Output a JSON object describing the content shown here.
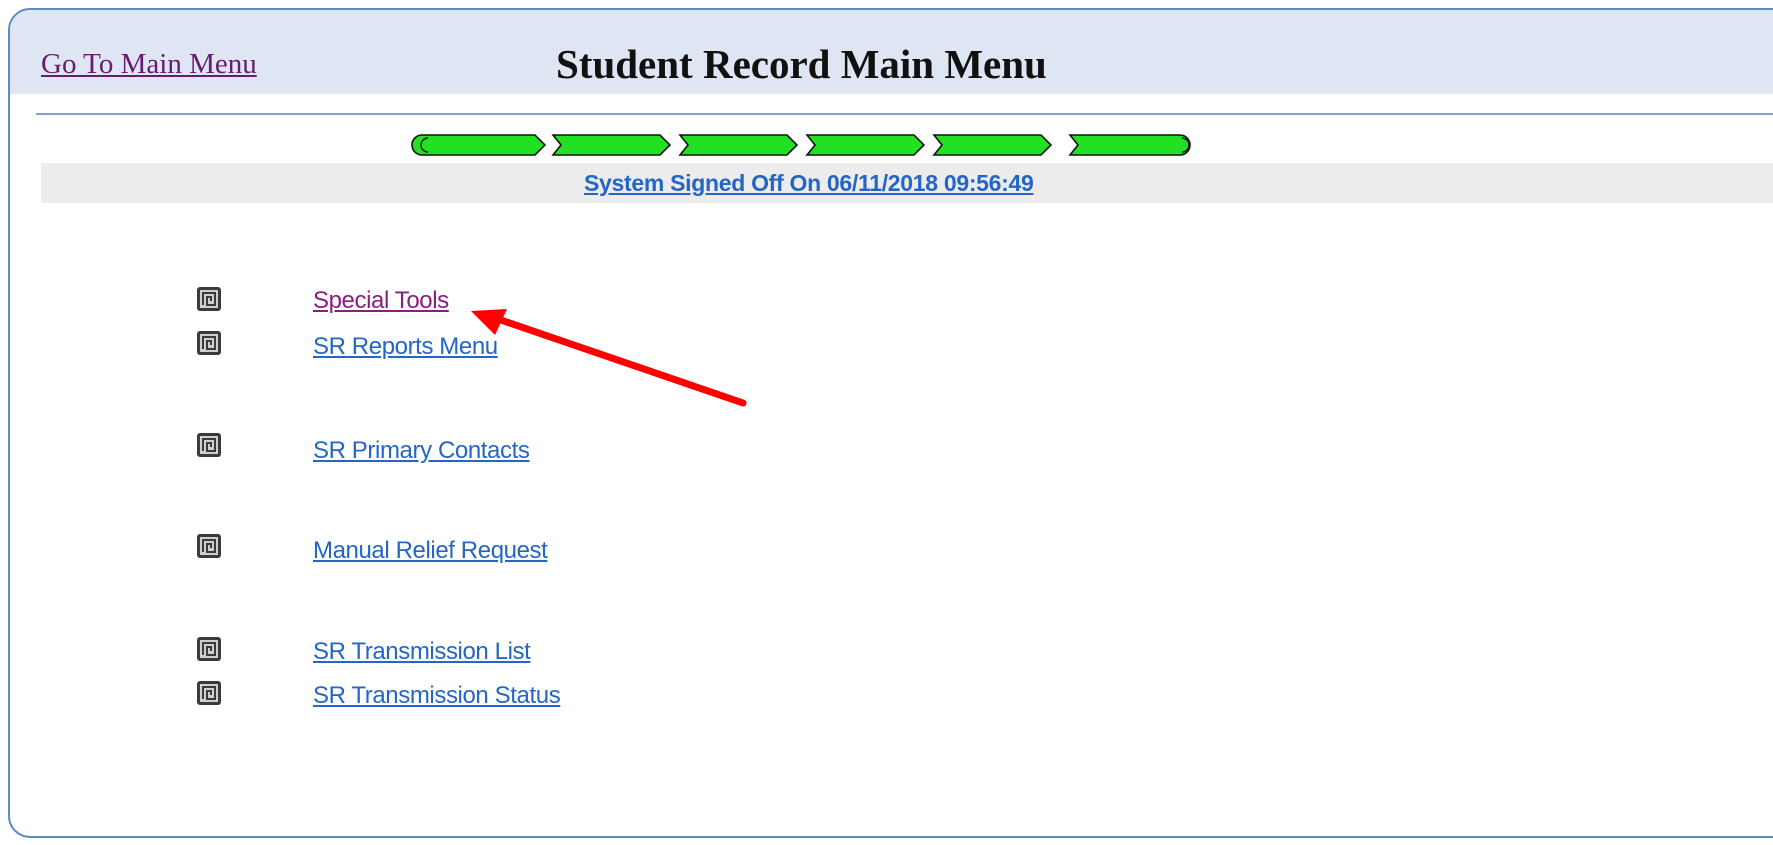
{
  "header": {
    "go_main_menu": "Go To Main Menu",
    "title": "Student Record Main Menu"
  },
  "progress": {
    "segments": 6,
    "color": "#22e022"
  },
  "status": {
    "text": "System Signed Off On  06/11/2018 09:56:49"
  },
  "menu": {
    "items": [
      {
        "label": "Special Tools",
        "visited": true
      },
      {
        "label": "SR Reports Menu",
        "visited": false
      },
      {
        "label": "SR Primary Contacts",
        "visited": false
      },
      {
        "label": "Manual Relief Request",
        "visited": false
      },
      {
        "label": "SR Transmission List",
        "visited": false
      },
      {
        "label": "SR Transmission Status",
        "visited": false
      }
    ],
    "icon": "square-spiral-icon"
  },
  "annotation": {
    "arrow_color": "#ff0000"
  },
  "colors": {
    "link": "#2366c7",
    "visited_link": "#8a1d7e",
    "header_bg": "#dde6f2",
    "frame_border": "#5b8ac4"
  }
}
